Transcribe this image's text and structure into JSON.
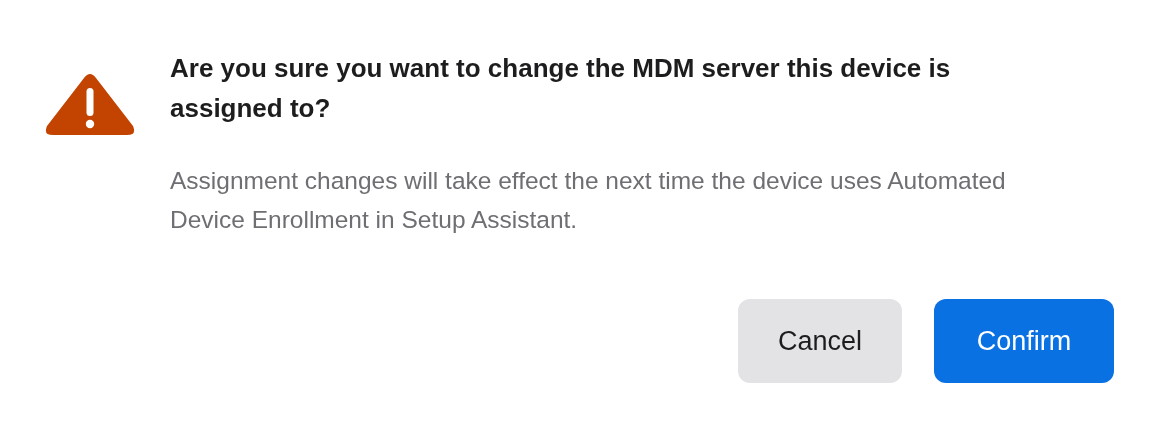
{
  "dialog": {
    "title": "Are you sure you want to change the MDM server this device is assigned to?",
    "message": "Assignment changes will take effect the next time the device uses Automated Device Enrollment in Setup Assistant.",
    "buttons": [
      {
        "label": "Cancel",
        "kind": "secondary"
      },
      {
        "label": "Confirm",
        "kind": "primary"
      }
    ]
  }
}
